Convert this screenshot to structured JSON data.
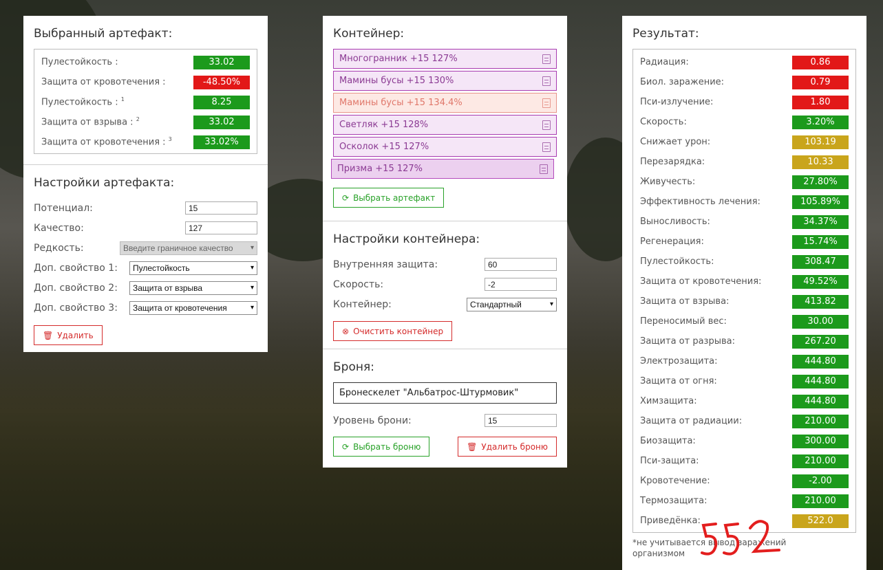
{
  "selected_artifact": {
    "title": "Выбранный артефакт:",
    "stats": [
      {
        "label": "Пулестойкость :",
        "sup": "",
        "value": "33.02",
        "color": "green"
      },
      {
        "label": "Защита от кровотечения :",
        "sup": "",
        "value": "-48.50%",
        "color": "red"
      },
      {
        "label": "Пулестойкость :",
        "sup": "1",
        "value": "8.25",
        "color": "green"
      },
      {
        "label": "Защита от взрыва :",
        "sup": "2",
        "value": "33.02",
        "color": "green"
      },
      {
        "label": "Защита от кровотечения :",
        "sup": "3",
        "value": "33.02%",
        "color": "green"
      }
    ]
  },
  "artifact_settings": {
    "title": "Настройки артефакта:",
    "potential_label": "Потенциал:",
    "potential_value": "15",
    "quality_label": "Качество:",
    "quality_value": "127",
    "rarity_label": "Редкость:",
    "rarity_placeholder": "Введите граничное качество",
    "prop1_label": "Доп. свойство 1:",
    "prop1_value": "Пулестойкость",
    "prop2_label": "Доп. свойство 2:",
    "prop2_value": "Защита от взрыва",
    "prop3_label": "Доп. свойство 3:",
    "prop3_value": "Защита от кровотечения",
    "delete_label": "Удалить"
  },
  "container": {
    "title": "Контейнер:",
    "items": [
      {
        "label": "Многогранник +15 127%",
        "style": "purple"
      },
      {
        "label": "Мамины бусы +15 130%",
        "style": "purple"
      },
      {
        "label": "Мамины бусы +15 134.4%",
        "style": "red"
      },
      {
        "label": "Светляк +15 128%",
        "style": "purple"
      },
      {
        "label": "Осколок +15 127%",
        "style": "purple"
      },
      {
        "label": "Призма +15 127%",
        "style": "selected"
      }
    ],
    "choose_label": "Выбрать артефакт"
  },
  "container_settings": {
    "title": "Настройки контейнера:",
    "inner_label": "Внутренняя защита:",
    "inner_value": "60",
    "speed_label": "Скорость:",
    "speed_value": "-2",
    "type_label": "Контейнер:",
    "type_value": "Стандартный",
    "clear_label": "Очистить контейнер"
  },
  "armor": {
    "title": "Броня:",
    "name": "Бронескелет \"Альбатрос-Штурмовик\"",
    "level_label": "Уровень брони:",
    "level_value": "15",
    "choose_label": "Выбрать броню",
    "delete_label": "Удалить броню"
  },
  "result": {
    "title": "Результат:",
    "stats": [
      {
        "label": "Радиация:",
        "value": "0.86",
        "color": "red"
      },
      {
        "label": "Биол. заражение:",
        "value": "0.79",
        "color": "red"
      },
      {
        "label": "Пси-излучение:",
        "value": "1.80",
        "color": "red"
      },
      {
        "label": "Скорость:",
        "value": "3.20%",
        "color": "green"
      },
      {
        "label": "Снижает урон:",
        "value": "103.19",
        "color": "yellow"
      },
      {
        "label": "Перезарядка:",
        "value": "10.33",
        "color": "yellow"
      },
      {
        "label": "Живучесть:",
        "value": "27.80%",
        "color": "green"
      },
      {
        "label": "Эффективность лечения:",
        "value": "105.89%",
        "color": "green"
      },
      {
        "label": "Выносливость:",
        "value": "34.37%",
        "color": "green"
      },
      {
        "label": "Регенерация:",
        "value": "15.74%",
        "color": "green"
      },
      {
        "label": "Пулестойкость:",
        "value": "308.47",
        "color": "green"
      },
      {
        "label": "Защита от кровотечения:",
        "value": "49.52%",
        "color": "green"
      },
      {
        "label": "Защита от взрыва:",
        "value": "413.82",
        "color": "green"
      },
      {
        "label": "Переносимый вес:",
        "value": "30.00",
        "color": "green"
      },
      {
        "label": "Защита от разрыва:",
        "value": "267.20",
        "color": "green"
      },
      {
        "label": "Электрозащита:",
        "value": "444.80",
        "color": "green"
      },
      {
        "label": "Защита от огня:",
        "value": "444.80",
        "color": "green"
      },
      {
        "label": "Химзащита:",
        "value": "444.80",
        "color": "green"
      },
      {
        "label": "Защита от радиации:",
        "value": "210.00",
        "color": "green"
      },
      {
        "label": "Биозащита:",
        "value": "300.00",
        "color": "green"
      },
      {
        "label": "Пси-защита:",
        "value": "210.00",
        "color": "green"
      },
      {
        "label": "Кровотечение:",
        "value": "-2.00",
        "color": "green"
      },
      {
        "label": "Термозащита:",
        "value": "210.00",
        "color": "green"
      },
      {
        "label": "Приведёнка:",
        "value": "522.0",
        "color": "yellow"
      }
    ],
    "note": "*не учитывается вывод заражений организмом",
    "annotation": "552"
  },
  "colors": {
    "green": "#1c9a1c",
    "red": "#e21818",
    "yellow": "#c9a51c"
  }
}
